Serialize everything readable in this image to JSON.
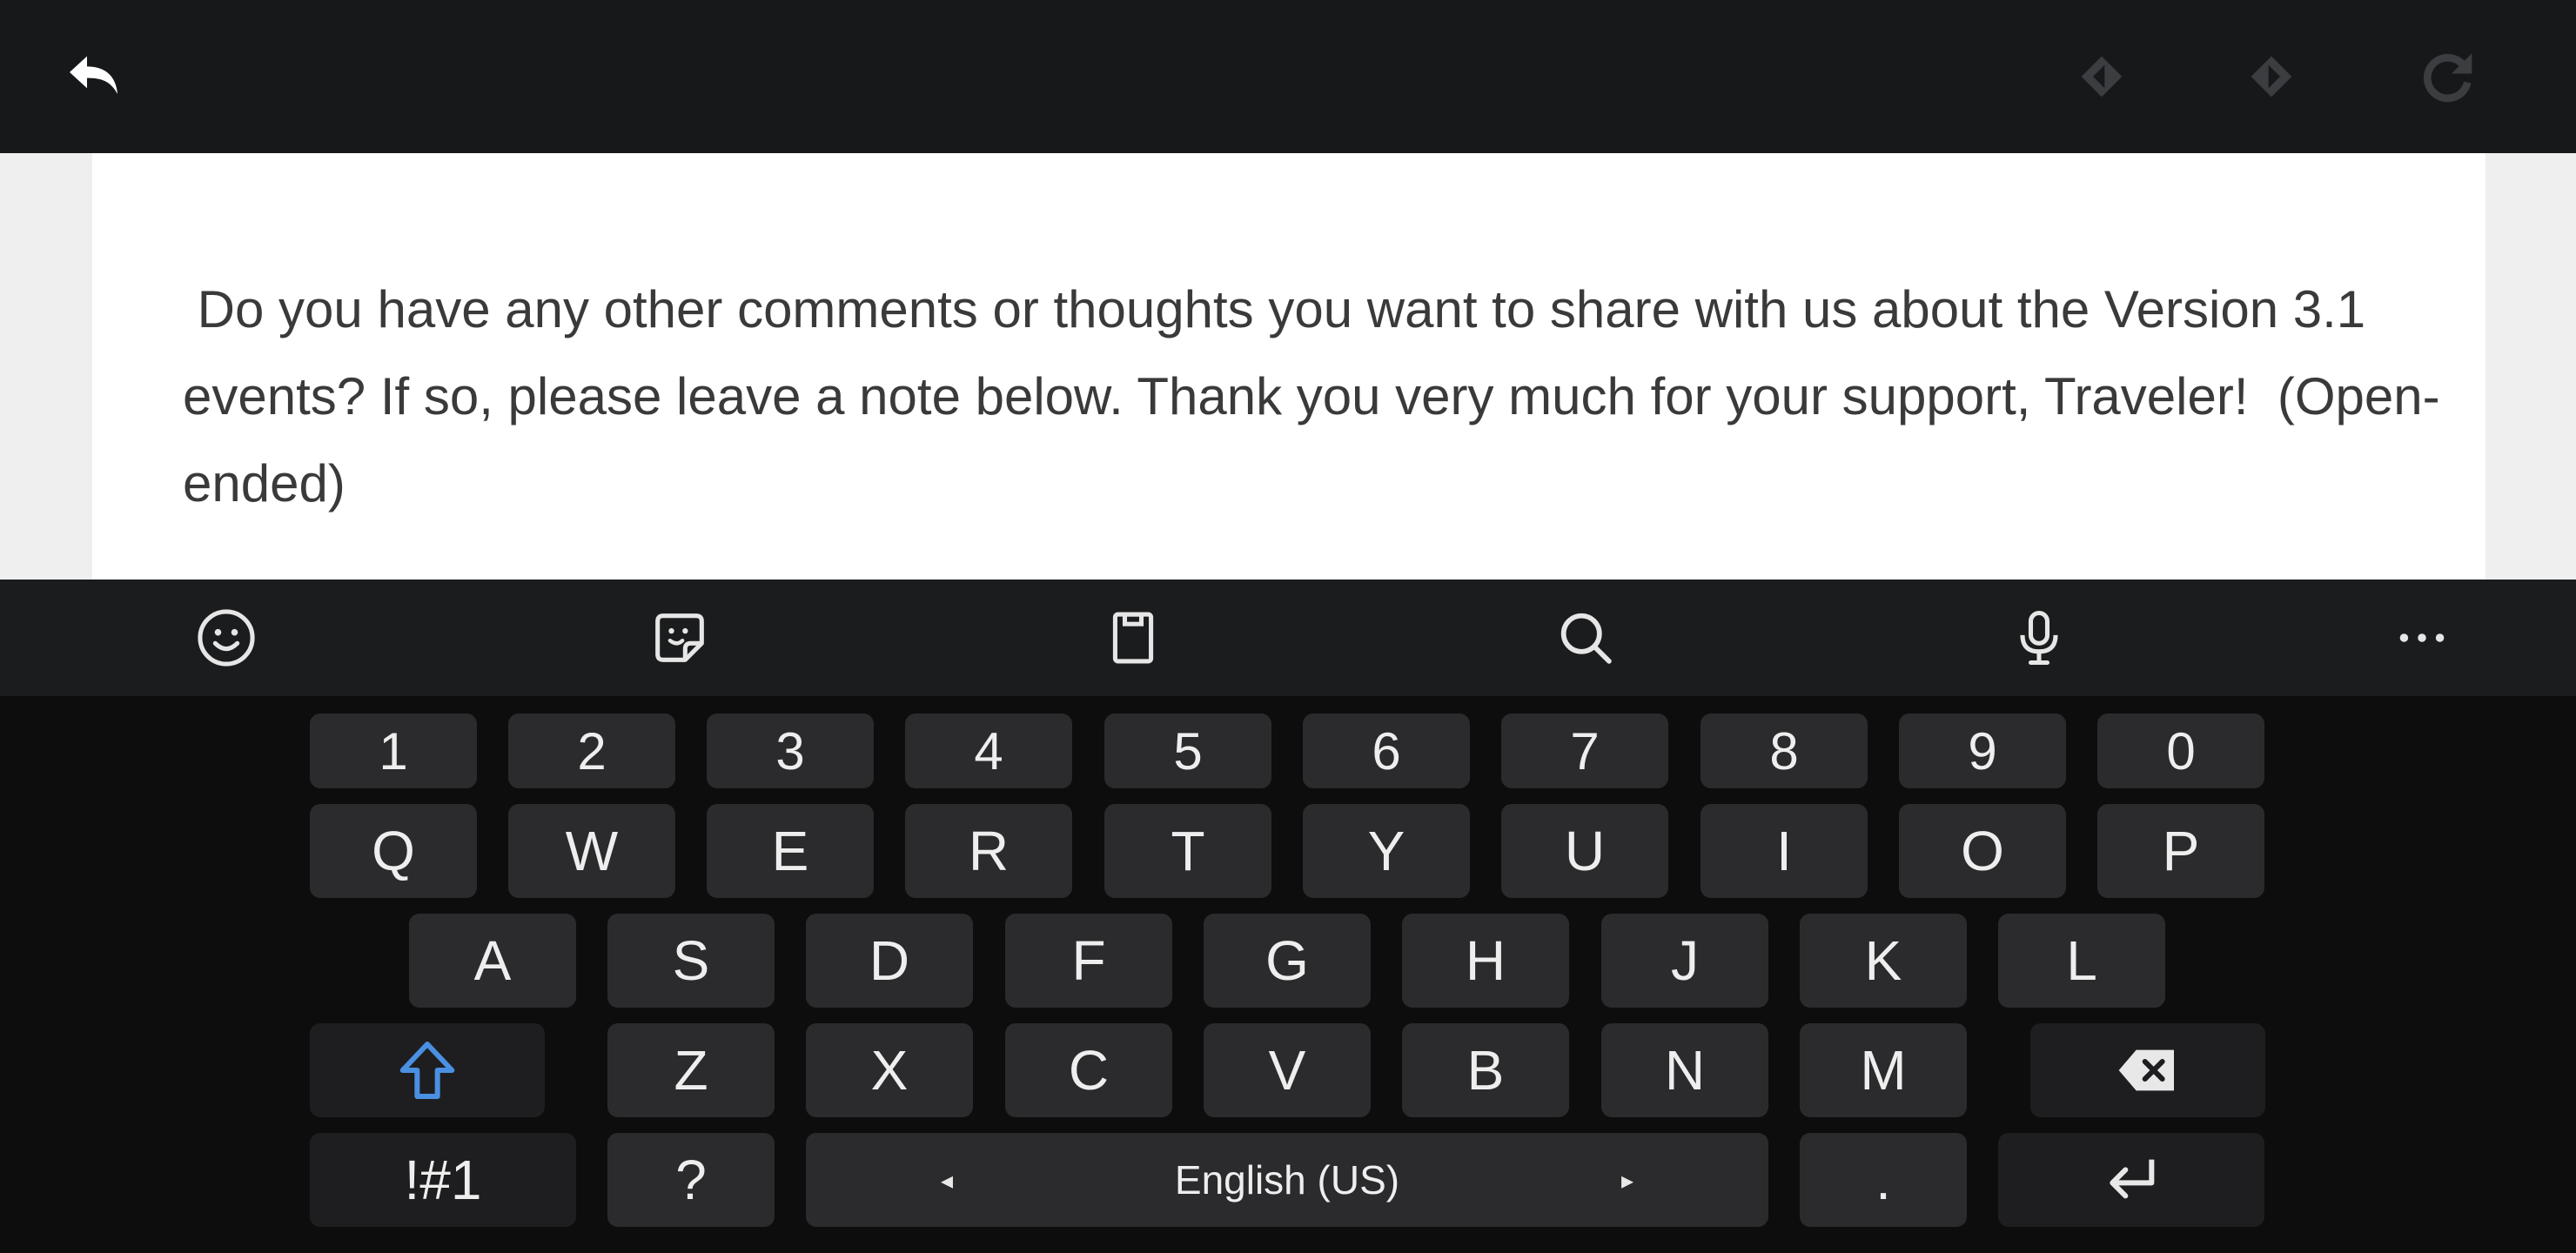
{
  "topbar": {
    "icons": [
      "back-icon",
      "previous-diamond-icon",
      "next-diamond-icon",
      "refresh-icon"
    ]
  },
  "question": {
    "text": " Do you have any other comments or thoughts you want to share with us about the Version 3.1 events? If so, please leave a note below. Thank you very much for your support, Traveler!  (Open-ended)"
  },
  "keyboard_toolbar": {
    "icons": [
      "emoji-icon",
      "sticker-icon",
      "clipboard-icon",
      "search-icon",
      "microphone-icon",
      "more-icon"
    ]
  },
  "keyboard": {
    "digits": [
      "1",
      "2",
      "3",
      "4",
      "5",
      "6",
      "7",
      "8",
      "9",
      "0"
    ],
    "row1": [
      "Q",
      "W",
      "E",
      "R",
      "T",
      "Y",
      "U",
      "I",
      "O",
      "P"
    ],
    "row2": [
      "A",
      "S",
      "D",
      "F",
      "G",
      "H",
      "J",
      "K",
      "L"
    ],
    "row3": [
      "Z",
      "X",
      "C",
      "V",
      "B",
      "N",
      "M"
    ],
    "symbols_label": "!#1",
    "question_label": "?",
    "space_label": "English (US)",
    "space_left_arrow": "◂",
    "space_right_arrow": "▸",
    "period_label": ".",
    "shift_color": "#4a90e2"
  }
}
